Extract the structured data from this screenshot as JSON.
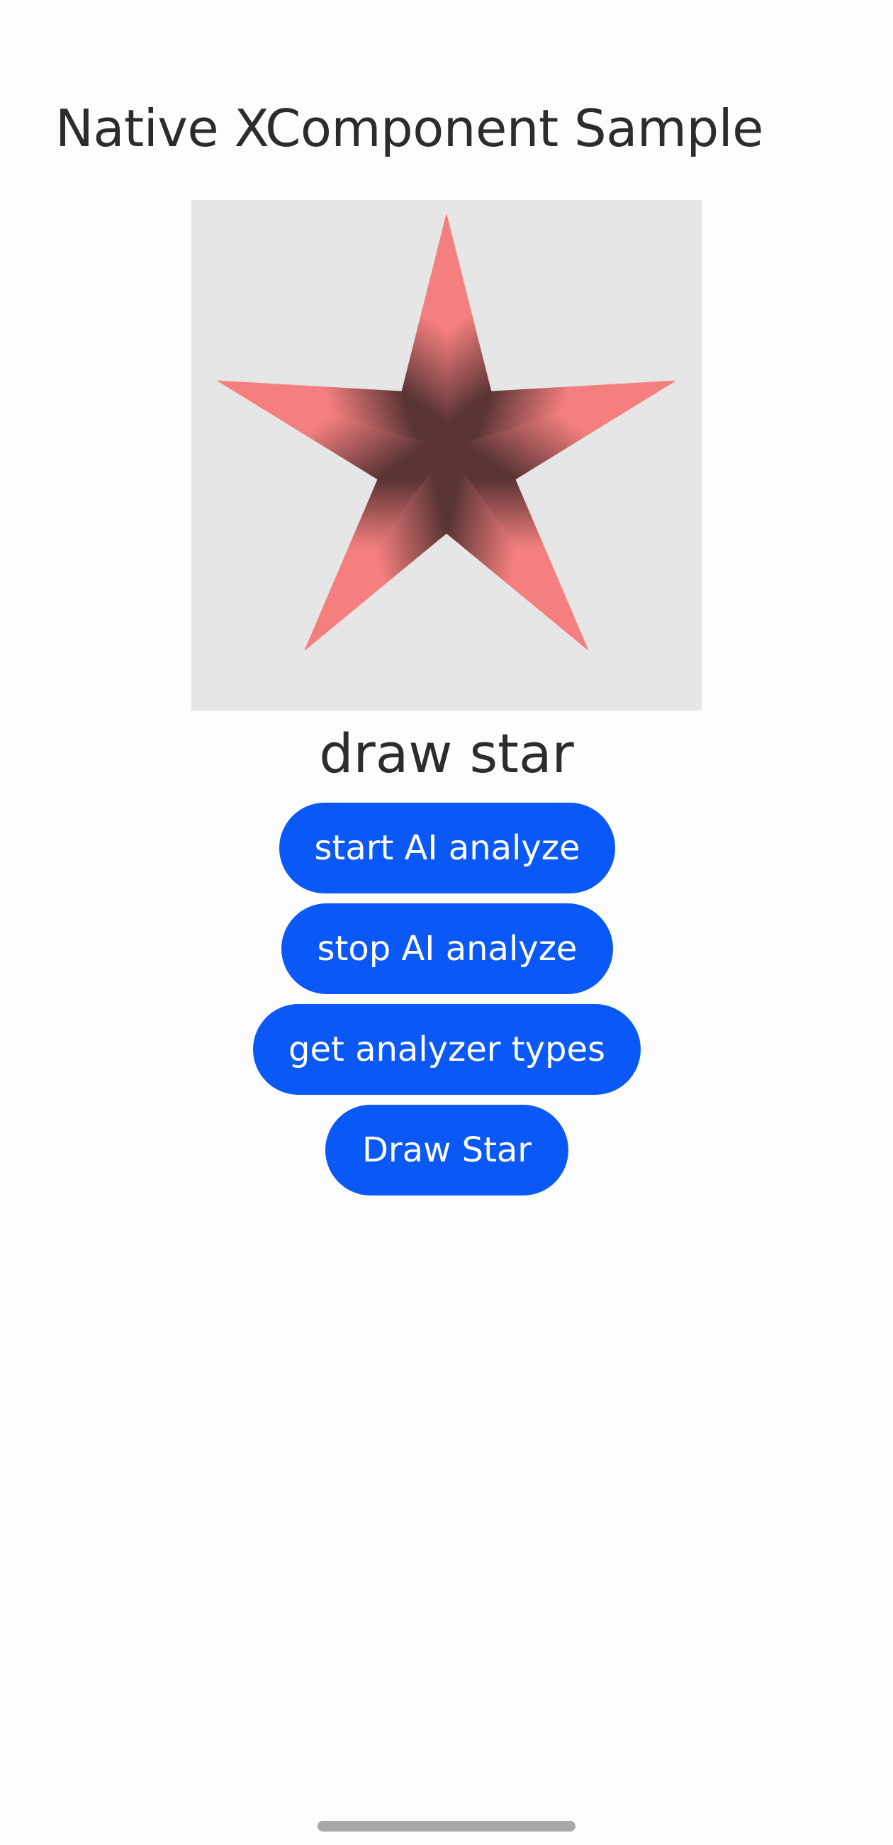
{
  "header": {
    "title": "Native XComponent Sample"
  },
  "xcomponent": {
    "content": "star-shape",
    "background_color": "#e6e6e6",
    "star_light_color": "#f57f7f",
    "star_dark_color": "#5a3434"
  },
  "status": {
    "text": "draw star"
  },
  "buttons": {
    "start_label": "start AI analyze",
    "stop_label": "stop AI analyze",
    "types_label": "get analyzer types",
    "draw_label": "Draw Star"
  },
  "colors": {
    "accent": "#0a59f7",
    "text": "#2c2c2c",
    "background": "#fdfdfd"
  }
}
